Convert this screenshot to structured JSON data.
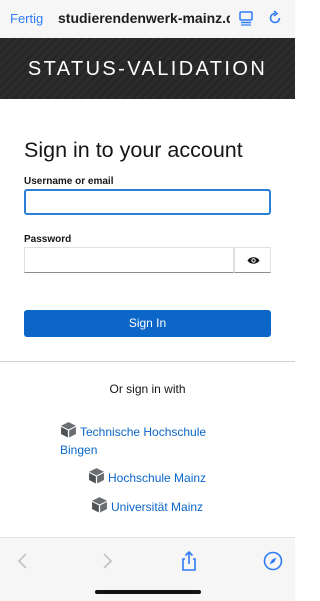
{
  "browser": {
    "done_label": "Fertig",
    "url": "studierendenwerk-mainz.de"
  },
  "banner": {
    "title": "STATUS-VALIDATION"
  },
  "login": {
    "heading": "Sign in to your account",
    "username_label": "Username or email",
    "username_value": "",
    "password_label": "Password",
    "password_value": "",
    "signin_label": "Sign In"
  },
  "social": {
    "heading": "Or sign in with",
    "providers": [
      {
        "label": "Technische Hochschule Bingen"
      },
      {
        "label": "Hochschule Mainz"
      },
      {
        "label": "Universität Mainz"
      }
    ]
  },
  "colors": {
    "link": "#0b66c8",
    "primary_button": "#0b66c8",
    "safari_blue": "#2f7cf6",
    "banner": "#2a2a2a"
  },
  "icons": {
    "reader": "reader-mode-icon",
    "reload": "reload-icon",
    "eye": "eye-icon",
    "provider": "cube-icon",
    "back": "chevron-left-icon",
    "forward": "chevron-right-icon",
    "share": "share-icon",
    "compass": "compass-icon"
  }
}
